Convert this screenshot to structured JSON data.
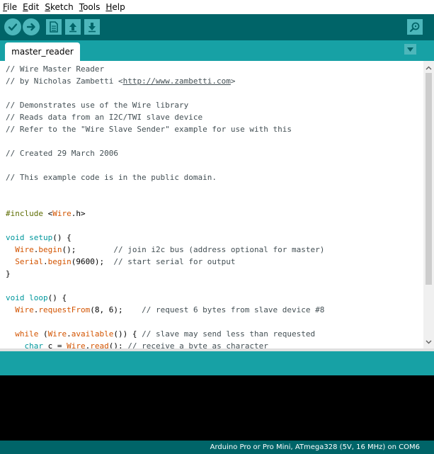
{
  "menubar": {
    "items": [
      {
        "label": "File",
        "accel": "F",
        "rest": "ile"
      },
      {
        "label": "Edit",
        "accel": "E",
        "rest": "dit"
      },
      {
        "label": "Sketch",
        "accel": "S",
        "rest": "ketch"
      },
      {
        "label": "Tools",
        "accel": "T",
        "rest": "ools"
      },
      {
        "label": "Help",
        "accel": "H",
        "rest": "elp"
      }
    ]
  },
  "toolbar": {
    "icons": [
      "verify-check-icon",
      "upload-arrow-icon",
      "new-file-icon",
      "open-up-arrow-icon",
      "save-down-arrow-icon",
      "serial-monitor-magnifier-icon"
    ],
    "accent": "#006468",
    "button_color": "#4db7bb"
  },
  "tabs": [
    {
      "label": "master_reader",
      "active": true
    }
  ],
  "editor": {
    "lines": [
      [
        {
          "t": "// Wire Master Reader",
          "c": "comment"
        }
      ],
      [
        {
          "t": "// by Nicholas Zambetti <",
          "c": "comment"
        },
        {
          "t": "http://www.zambetti.com",
          "c": "link"
        },
        {
          "t": ">",
          "c": "comment"
        }
      ],
      [],
      [
        {
          "t": "// Demonstrates use of the Wire library",
          "c": "comment"
        }
      ],
      [
        {
          "t": "// Reads data from an I2C/TWI slave device",
          "c": "comment"
        }
      ],
      [
        {
          "t": "// Refer to the \"Wire Slave Sender\" example for use with this",
          "c": "comment"
        }
      ],
      [],
      [
        {
          "t": "// Created 29 March 2006",
          "c": "comment"
        }
      ],
      [],
      [
        {
          "t": "// This example code is in the public domain.",
          "c": "comment"
        }
      ],
      [],
      [],
      [
        {
          "t": "#include ",
          "c": "pp"
        },
        {
          "t": "<",
          "c": "plain"
        },
        {
          "t": "Wire",
          "c": "kw"
        },
        {
          "t": ".h>",
          "c": "plain"
        }
      ],
      [],
      [
        {
          "t": "void",
          "c": "type"
        },
        {
          "t": " ",
          "c": "plain"
        },
        {
          "t": "setup",
          "c": "type"
        },
        {
          "t": "() {",
          "c": "plain"
        }
      ],
      [
        {
          "t": "  ",
          "c": "plain"
        },
        {
          "t": "Wire",
          "c": "kw"
        },
        {
          "t": ".",
          "c": "plain"
        },
        {
          "t": "begin",
          "c": "kw"
        },
        {
          "t": "();        ",
          "c": "plain"
        },
        {
          "t": "// join i2c bus (address optional for master)",
          "c": "comment"
        }
      ],
      [
        {
          "t": "  ",
          "c": "plain"
        },
        {
          "t": "Serial",
          "c": "kw"
        },
        {
          "t": ".",
          "c": "plain"
        },
        {
          "t": "begin",
          "c": "kw"
        },
        {
          "t": "(9600);  ",
          "c": "plain"
        },
        {
          "t": "// start serial for output",
          "c": "comment"
        }
      ],
      [
        {
          "t": "}",
          "c": "plain"
        }
      ],
      [],
      [
        {
          "t": "void",
          "c": "type"
        },
        {
          "t": " ",
          "c": "plain"
        },
        {
          "t": "loop",
          "c": "type"
        },
        {
          "t": "() {",
          "c": "plain"
        }
      ],
      [
        {
          "t": "  ",
          "c": "plain"
        },
        {
          "t": "Wire",
          "c": "kw"
        },
        {
          "t": ".",
          "c": "plain"
        },
        {
          "t": "requestFrom",
          "c": "kw"
        },
        {
          "t": "(8, 6);    ",
          "c": "plain"
        },
        {
          "t": "// request 6 bytes from slave device #8",
          "c": "comment"
        }
      ],
      [],
      [
        {
          "t": "  ",
          "c": "plain"
        },
        {
          "t": "while",
          "c": "kw"
        },
        {
          "t": " (",
          "c": "plain"
        },
        {
          "t": "Wire",
          "c": "kw"
        },
        {
          "t": ".",
          "c": "plain"
        },
        {
          "t": "available",
          "c": "kw"
        },
        {
          "t": "()) { ",
          "c": "plain"
        },
        {
          "t": "// slave may send less than requested",
          "c": "comment"
        }
      ],
      [
        {
          "t": "    ",
          "c": "plain"
        },
        {
          "t": "char",
          "c": "type"
        },
        {
          "t": " c = ",
          "c": "plain"
        },
        {
          "t": "Wire",
          "c": "kw"
        },
        {
          "t": ".",
          "c": "plain"
        },
        {
          "t": "read",
          "c": "kw"
        },
        {
          "t": "(); ",
          "c": "plain"
        },
        {
          "t": "// receive a byte as character",
          "c": "comment"
        }
      ]
    ]
  },
  "status": {
    "board": "Arduino Pro or Pro Mini, ATmega328 (5V, 16 MHz) on COM6"
  }
}
